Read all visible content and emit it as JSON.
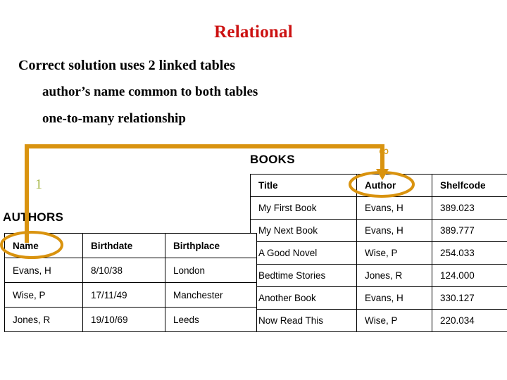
{
  "slide": {
    "title": "Relational",
    "title_color": "#cc1111",
    "background": "#ffffff"
  },
  "bullets": [
    {
      "text": "Correct solution uses 2 linked tables",
      "level": 0
    },
    {
      "text": "author’s name common to both tables",
      "level": 1
    },
    {
      "text": "one-to-many relationship",
      "level": 1
    }
  ],
  "diagram": {
    "accent_color": "#d9930f",
    "one_label": "1",
    "one_label_color": "#a8b84a",
    "many_label": "∞",
    "many_label_color": "#d9970f",
    "highlighted_fields": [
      "Name",
      "Author"
    ],
    "connector": "AUTHORS.Name to BOOKS.Author"
  },
  "tables": {
    "books": {
      "label": "BOOKS",
      "columns": [
        "Title",
        "Author",
        "Shelfcode"
      ],
      "rows": [
        [
          "My First Book",
          "Evans, H",
          "389.023"
        ],
        [
          "My Next Book",
          "Evans, H",
          "389.777"
        ],
        [
          "A Good Novel",
          "Wise, P",
          "254.033"
        ],
        [
          "Bedtime Stories",
          "Jones, R",
          "124.000"
        ],
        [
          "Another Book",
          "Evans, H",
          "330.127"
        ],
        [
          "Now Read This",
          "Wise, P",
          "220.034"
        ]
      ]
    },
    "authors": {
      "label": "AUTHORS",
      "columns": [
        "Name",
        "Birthdate",
        "Birthplace"
      ],
      "rows": [
        [
          "Evans, H",
          "8/10/38",
          "London"
        ],
        [
          "Wise, P",
          "17/11/49",
          "Manchester"
        ],
        [
          "Jones, R",
          "19/10/69",
          "Leeds"
        ]
      ]
    }
  }
}
